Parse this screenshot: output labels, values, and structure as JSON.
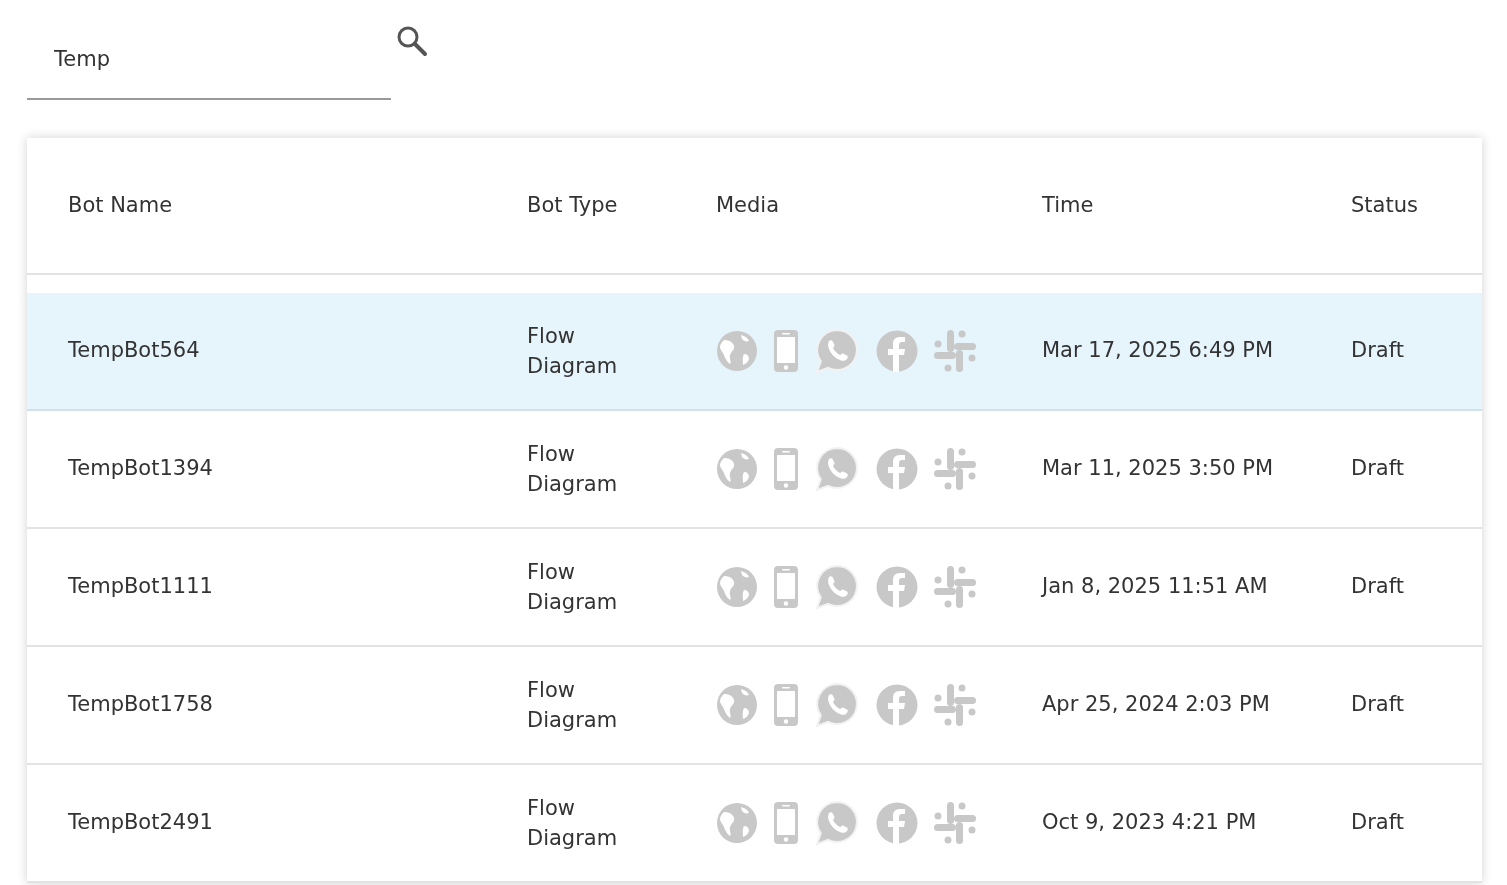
{
  "search": {
    "value": "Temp"
  },
  "table": {
    "columns": [
      "Bot Name",
      "Bot Type",
      "Media",
      "Time",
      "Status"
    ],
    "rows": [
      {
        "name": "TempBot564",
        "type": "Flow Diagram",
        "media": [
          {
            "kind": "web"
          },
          {
            "kind": "mobile"
          },
          {
            "kind": "whatsapp"
          },
          {
            "kind": "facebook"
          },
          {
            "kind": "slack"
          }
        ],
        "time": "Mar 17, 2025 6:49 PM",
        "status": "Draft",
        "selected": true
      },
      {
        "name": "TempBot1394",
        "type": "Flow Diagram",
        "media": [
          {
            "kind": "web"
          },
          {
            "kind": "mobile"
          },
          {
            "kind": "whatsapp"
          },
          {
            "kind": "facebook"
          },
          {
            "kind": "slack"
          }
        ],
        "time": "Mar 11, 2025 3:50 PM",
        "status": "Draft",
        "selected": false
      },
      {
        "name": "TempBot1111",
        "type": "Flow Diagram",
        "media": [
          {
            "kind": "web"
          },
          {
            "kind": "mobile"
          },
          {
            "kind": "whatsapp"
          },
          {
            "kind": "facebook"
          },
          {
            "kind": "slack"
          }
        ],
        "time": "Jan 8, 2025 11:51 AM",
        "status": "Draft",
        "selected": false
      },
      {
        "name": "TempBot1758",
        "type": "Flow Diagram",
        "media": [
          {
            "kind": "web"
          },
          {
            "kind": "mobile"
          },
          {
            "kind": "whatsapp"
          },
          {
            "kind": "facebook"
          },
          {
            "kind": "slack"
          }
        ],
        "time": "Apr 25, 2024 2:03 PM",
        "status": "Draft",
        "selected": false
      },
      {
        "name": "TempBot2491",
        "type": "Flow Diagram",
        "media": [
          {
            "kind": "web"
          },
          {
            "kind": "mobile"
          },
          {
            "kind": "whatsapp"
          },
          {
            "kind": "facebook"
          },
          {
            "kind": "slack"
          }
        ],
        "time": "Oct 9, 2023 4:21 PM",
        "status": "Draft",
        "selected": false
      }
    ]
  }
}
